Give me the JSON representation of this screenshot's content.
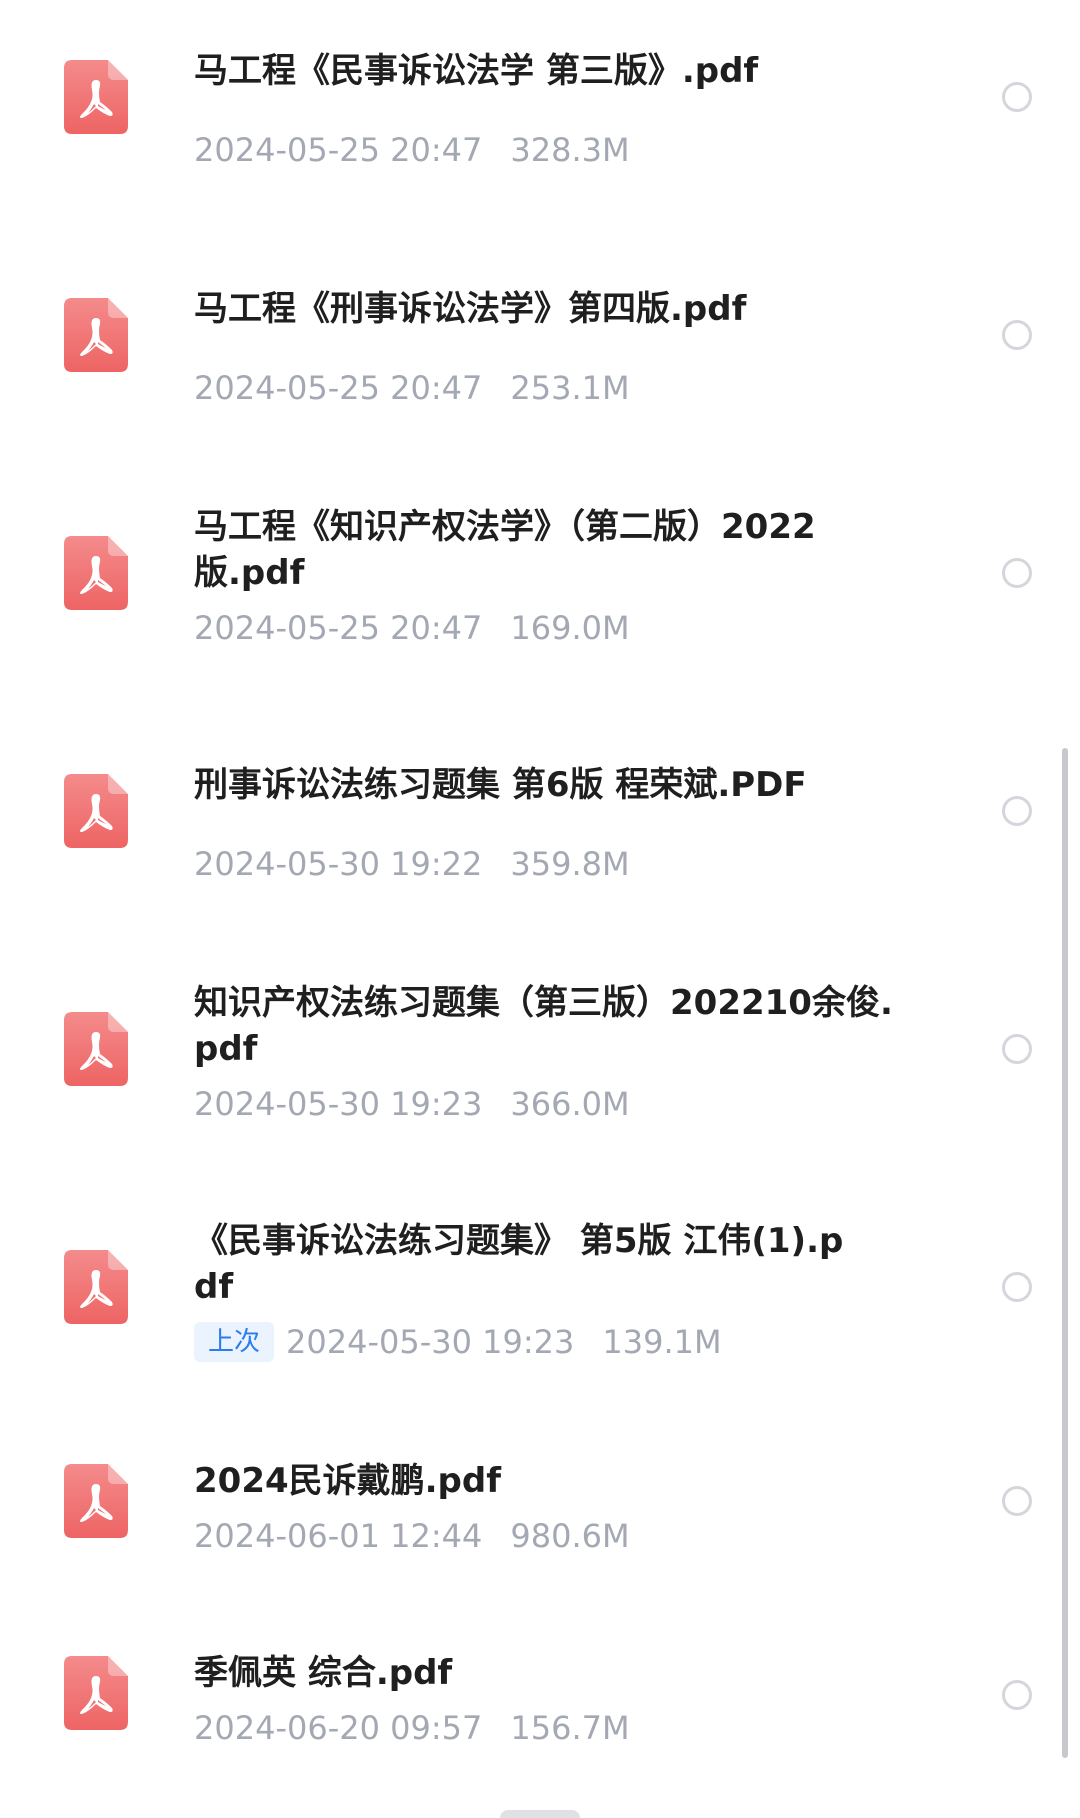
{
  "files": [
    {
      "name": "马工程《民事诉讼法学 第三版》.pdf",
      "date": "2024-05-25 20:47",
      "size": "328.3M",
      "tag": "",
      "icon": "pdf-file-icon"
    },
    {
      "name": "马工程《刑事诉讼法学》第四版.pdf",
      "date": "2024-05-25 20:47",
      "size": "253.1M",
      "tag": "",
      "icon": "pdf-file-icon"
    },
    {
      "name": "马工程《知识产权法学》（第二版）2022版.pdf",
      "date": "2024-05-25 20:47",
      "size": "169.0M",
      "tag": "",
      "icon": "pdf-file-icon"
    },
    {
      "name": "刑事诉讼法练习题集 第6版 程荣斌.PDF",
      "date": "2024-05-30 19:22",
      "size": "359.8M",
      "tag": "",
      "icon": "pdf-file-icon"
    },
    {
      "name": "知识产权法练习题集（第三版）202210余俊.pdf",
      "date": "2024-05-30 19:23",
      "size": "366.0M",
      "tag": "",
      "icon": "pdf-file-icon"
    },
    {
      "name": "《民事诉讼法练习题集》 第5版 江伟(1).pdf",
      "date": "2024-05-30 19:23",
      "size": "139.1M",
      "tag": "上次",
      "icon": "pdf-file-icon"
    },
    {
      "name": "2024民诉戴鹏.pdf",
      "date": "2024-06-01 12:44",
      "size": "980.6M",
      "tag": "",
      "icon": "pdf-file-icon"
    },
    {
      "name": "季佩英 综合.pdf",
      "date": "2024-06-20 09:57",
      "size": "156.7M",
      "tag": "",
      "icon": "pdf-file-icon"
    }
  ],
  "colors": {
    "pdf_icon": "#f26d6d",
    "meta_text": "#a3a8b3",
    "tag_bg": "#eaf3fe",
    "tag_text": "#2a7df0"
  }
}
